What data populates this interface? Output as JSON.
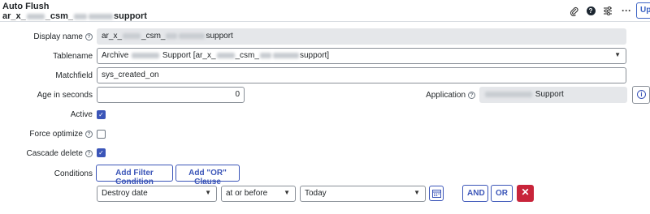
{
  "header": {
    "record_type": "Auto Flush",
    "record_name_prefix": "ar_x_",
    "record_name_mid": "_csm_",
    "record_name_suffix": "support",
    "partial_button_label": "Up",
    "icons": [
      "paperclip-icon",
      "help-icon",
      "sliders-icon",
      "more-icon"
    ]
  },
  "form": {
    "display_name": {
      "label": "Display name",
      "value_prefix": "ar_x_",
      "value_mid": "_csm_",
      "value_suffix": "support"
    },
    "tablename": {
      "label": "Tablename",
      "value_prefix": "Archive ",
      "value_mid": " Support [ar_x_",
      "value_mid2": "_csm_",
      "value_suffix": "support]"
    },
    "matchfield": {
      "label": "Matchfield",
      "value": "sys_created_on"
    },
    "age_in_seconds": {
      "label": "Age in seconds",
      "value": "0"
    },
    "application": {
      "label": "Application",
      "value_suffix": "Support"
    },
    "active": {
      "label": "Active",
      "checked": true
    },
    "force_optimize": {
      "label": "Force optimize",
      "checked": false
    },
    "cascade_delete": {
      "label": "Cascade delete",
      "checked": true
    },
    "conditions": {
      "label": "Conditions",
      "add_filter_label": "Add Filter Condition",
      "add_or_label": "Add \"OR\" Clause",
      "field_value": "Destroy date",
      "operator_value": "at or before",
      "date_value": "Today",
      "and_label": "AND",
      "or_label": "OR"
    }
  },
  "colors": {
    "accent": "#3b55b8",
    "danger": "#c8243a",
    "readonly_bg": "#e5e7ea"
  }
}
